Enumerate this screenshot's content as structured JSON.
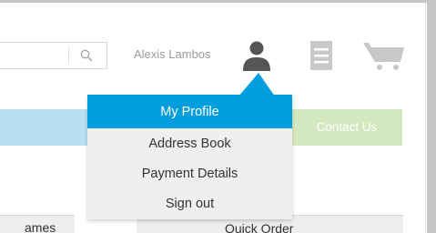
{
  "header": {
    "search": {
      "value": "",
      "placeholder": "",
      "icon": "search-icon"
    },
    "user_name": "Alexis Lambos",
    "icons": {
      "account": "person-icon",
      "list": "list-icon",
      "cart": "cart-icon"
    }
  },
  "nav": {
    "contact_label": "Contact Us"
  },
  "account_menu": {
    "items": [
      {
        "label": "My Profile",
        "active": true
      },
      {
        "label": "Address Book",
        "active": false
      },
      {
        "label": "Payment Details",
        "active": false
      },
      {
        "label": "Sign out",
        "active": false
      }
    ]
  },
  "content": {
    "left_tab_label": "ames",
    "quick_order_label": "Quick Order"
  },
  "colors": {
    "accent": "#009ddf",
    "nav_blue": "#b9dff3",
    "nav_green": "#d4e8bf",
    "icon_gray": "#555555",
    "muted_icon": "#c8c8c8"
  }
}
